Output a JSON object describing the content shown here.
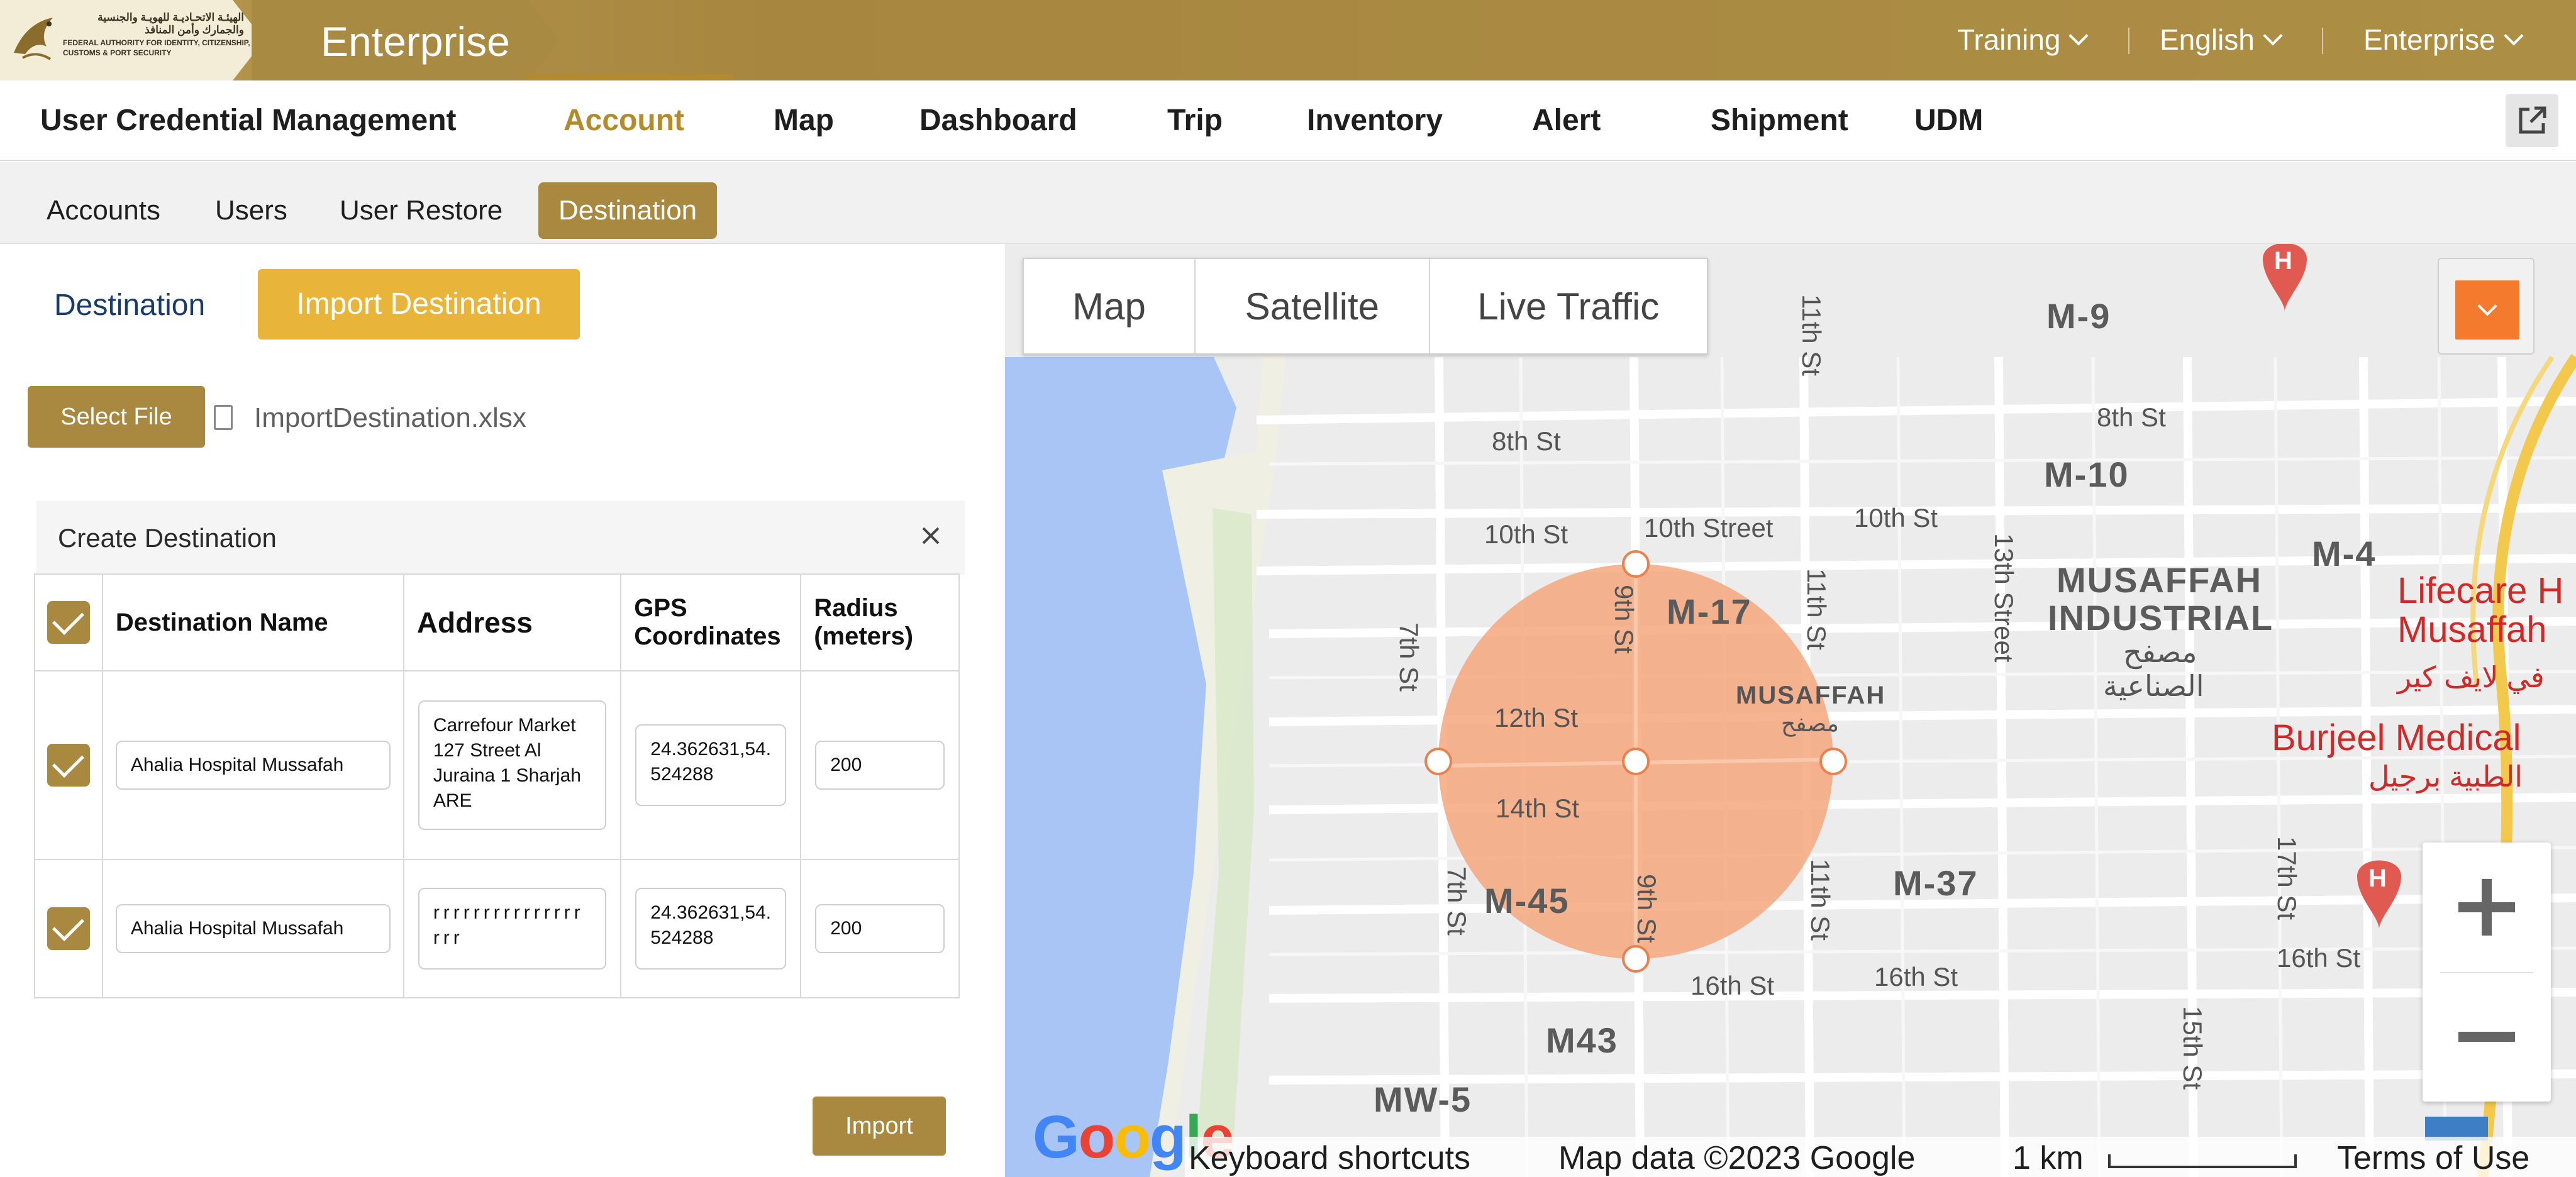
{
  "header": {
    "logo_ar": "الهيئـة الاتحـاديـة للهويـة والجنسية والجمارك وأمن المنافذ",
    "logo_en": "FEDERAL AUTHORITY FOR IDENTITY, CITIZENSHIP, CUSTOMS & PORT SECURITY",
    "brand": "Enterprise",
    "dropdowns": [
      "Training",
      "English",
      "Enterprise"
    ]
  },
  "main_nav": {
    "items": [
      "User Credential Management",
      "Account",
      "Map",
      "Dashboard",
      "Trip",
      "Inventory",
      "Alert",
      "Shipment",
      "UDM"
    ],
    "active": "Account"
  },
  "sub_nav": {
    "items": [
      "Accounts",
      "Users",
      "User Restore",
      "Destination"
    ],
    "active": "Destination"
  },
  "destination_tabs": {
    "destination": "Destination",
    "import": "Import Destination"
  },
  "file": {
    "select_label": "Select File",
    "filename": "ImportDestination.xlsx"
  },
  "create": {
    "title": "Create Destination",
    "columns": [
      "Destination Name",
      "Address",
      "GPS Coordinates",
      "Radius (meters)"
    ],
    "rows": [
      {
        "checked": true,
        "name": "Ahalia Hospital Mussafah",
        "address": "Carrefour Market 127 Street Al Juraina 1 Sharjah ARE",
        "gps": "24.362631,54.524288",
        "radius": "200"
      },
      {
        "checked": true,
        "name": "Ahalia Hospital Mussafah",
        "address": "rrrrrrrrrrrrrrrrrr",
        "gps": "24.362631,54.524288",
        "radius": "200"
      }
    ],
    "import_label": "Import"
  },
  "map": {
    "types": [
      "Map",
      "Satellite",
      "Live Traffic"
    ],
    "labels": {
      "m9": "M-9",
      "m10": "M-10",
      "m4": "M-4",
      "m17": "M-17",
      "m37": "M-37",
      "m45": "M-45",
      "m43": "M43",
      "mw5": "MW-5",
      "st8": "8th St",
      "st10a": "10th St",
      "st10street": "10th Street",
      "st10b": "10th St",
      "st12": "12th St",
      "st14": "14th St",
      "st16a": "16th St",
      "st16b": "16th St",
      "st16c": "16th St",
      "st7a": "7th St",
      "st7b": "7th St",
      "st9a": "9th St",
      "st9b": "9th St",
      "st11a": "11th St",
      "st11b": "11th St",
      "st11c": "11th St",
      "st13": "13th Street",
      "st15": "15th St",
      "st17": "17th St",
      "musaffah_ind1": "MUSAFFAH",
      "musaffah_ind2": "INDUSTRIAL",
      "musaffah_ar1": "مصفح",
      "musaffah_ar2": "الصناعية",
      "musaffah": "MUSAFFAH",
      "musaffah_ar": "مصفح",
      "lifecare1": "Lifecare H",
      "lifecare2": "Musaffah",
      "lifecare_ar": "في لايف كير",
      "burjeel": "Burjeel Medical",
      "burjeel_ar": "الطبية برجيل"
    },
    "footer": {
      "shortcuts": "Keyboard shortcuts",
      "data": "Map data ©2023 Google",
      "scale": "1 km",
      "terms": "Terms of Use"
    },
    "google": "Google",
    "colors": {
      "geofence": "#f4a77e",
      "water": "#a8c5f5",
      "road": "#ffffff",
      "highway": "#f2c94c"
    }
  }
}
